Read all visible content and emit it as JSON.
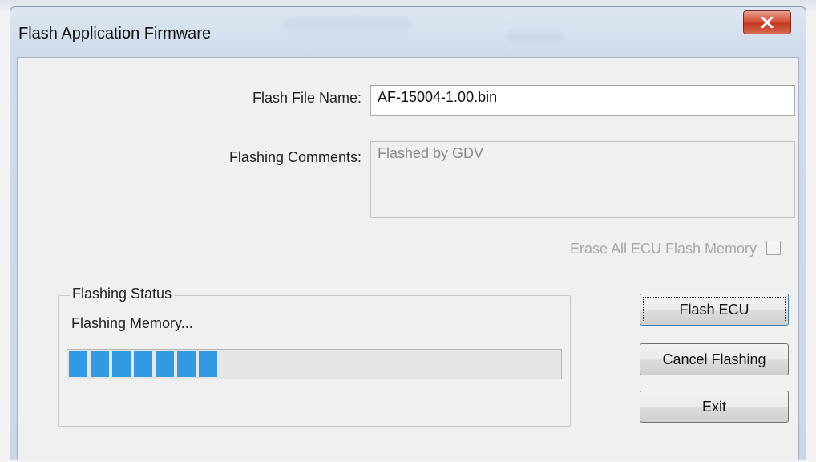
{
  "window": {
    "title": "Flash Application Firmware",
    "close_icon": "close-icon"
  },
  "form": {
    "file_name_label": "Flash File Name:",
    "file_name_value": "AF-15004-1.00.bin",
    "comments_label": "Flashing Comments:",
    "comments_value": "Flashed by GDV",
    "erase_label": "Erase All ECU Flash Memory",
    "erase_checked": false
  },
  "status": {
    "group_title": "Flashing Status",
    "message": "Flashing Memory...",
    "progress_fraction": 0.32,
    "progress_color": "#3399e0"
  },
  "buttons": {
    "flash": "Flash ECU",
    "cancel": "Cancel Flashing",
    "exit": "Exit"
  },
  "colors": {
    "close_button": "#c23a22",
    "title_bar": "#cfdcec",
    "client_bg": "#f0f0f0"
  }
}
